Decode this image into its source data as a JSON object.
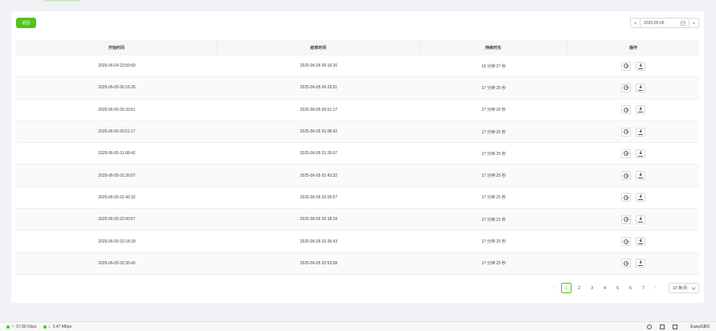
{
  "toolbar": {
    "back_label": "返回"
  },
  "date_picker": {
    "value": "2025-06-05",
    "prev": "‹",
    "next": "›"
  },
  "table": {
    "headers": [
      "开始时间",
      "结束时间",
      "持续时长",
      "操作"
    ],
    "rows": [
      {
        "start": "2025-06-04 23:59:59",
        "end": "2025-06-05 00:16:26",
        "duration": "16 分钟 27 秒"
      },
      {
        "start": "2025-06-05 00:16:26",
        "end": "2025-06-05 00:33:51",
        "duration": "17 分钟 25 秒"
      },
      {
        "start": "2025-06-05 00:33:51",
        "end": "2025-06-05 00:51:17",
        "duration": "17 分钟 26 秒"
      },
      {
        "start": "2025-06-05 00:51:17",
        "end": "2025-06-05 01:08:42",
        "duration": "17 分钟 25 秒"
      },
      {
        "start": "2025-06-05 01:08:42",
        "end": "2025-06-05 01:26:07",
        "duration": "17 分钟 25 秒"
      },
      {
        "start": "2025-06-05 01:26:07",
        "end": "2025-06-05 01:43:32",
        "duration": "17 分钟 25 秒"
      },
      {
        "start": "2025-06-05 01:43:32",
        "end": "2025-06-05 02:00:57",
        "duration": "17 分钟 25 秒"
      },
      {
        "start": "2025-06-05 02:00:57",
        "end": "2025-06-05 02:18:18",
        "duration": "17 分钟 21 秒"
      },
      {
        "start": "2025-06-05 02:18:18",
        "end": "2025-06-05 02:35:43",
        "duration": "17 分钟 25 秒"
      },
      {
        "start": "2025-06-05 02:35:43",
        "end": "2025-06-05 02:53:08",
        "duration": "17 分钟 25 秒"
      }
    ],
    "row_actions": {
      "play_icon": "play-circle-icon",
      "download_icon": "download-icon"
    }
  },
  "pagination": {
    "prev": "‹",
    "next": "›",
    "pages": [
      "1",
      "2",
      "3",
      "4",
      "5",
      "6",
      "7"
    ],
    "current": "1",
    "page_size": "10 条/页"
  },
  "statusbar": {
    "upload": "57.89 Kbps",
    "download": "3.47 Mbps",
    "up_arrow": "↑",
    "down_arrow": "↓",
    "brand": "EasyGBS"
  },
  "colors": {
    "accent": "#52c41a",
    "background": "#f0f2f5"
  }
}
